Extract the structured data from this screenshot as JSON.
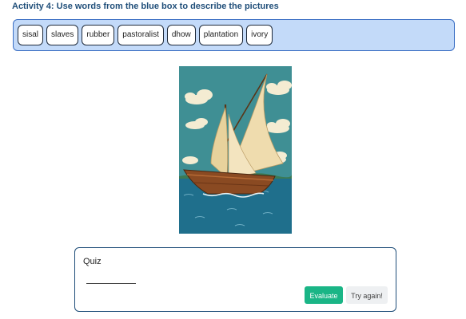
{
  "activity": {
    "title": "Activity 4: Use words from the blue box to describe the pictures"
  },
  "word_bank": {
    "words": [
      "sisal",
      "slaves",
      "rubber",
      "pastoralist",
      "dhow",
      "plantation",
      "ivory"
    ],
    "background_color": "#c3daf9",
    "border_color": "#3b6fc4"
  },
  "picture": {
    "icon": "dhow-sailboat-illustration"
  },
  "quiz": {
    "title": "Quiz",
    "answer_value": "",
    "evaluate_label": "Evaluate",
    "try_again_label": "Try again!",
    "evaluate_color": "#1ab586"
  }
}
